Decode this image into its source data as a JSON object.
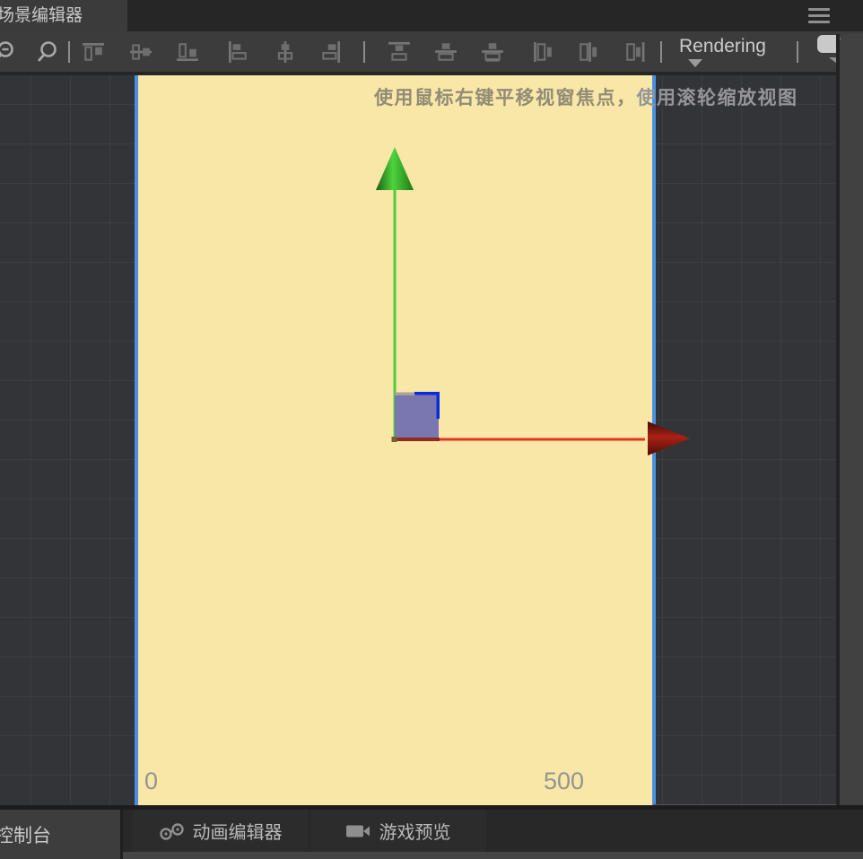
{
  "top_tabbar": {
    "tabs": [
      {
        "label": "场景编辑器",
        "active": true
      }
    ],
    "menu_icon": "hamburger-icon"
  },
  "toolbar": {
    "zoom_icons": [
      "zoom-out-icon",
      "zoom-in-icon"
    ],
    "align_icons": [
      "align-top-icon",
      "align-middle-icon",
      "align-bottom-icon",
      "align-left-icon",
      "align-center-icon",
      "align-right-icon"
    ],
    "distribute_icons": [
      "distribute-top-icon",
      "distribute-vcenter-icon",
      "distribute-bottom-icon",
      "distribute-left-icon",
      "distribute-hcenter-icon",
      "distribute-right-icon"
    ],
    "rendering_label": "Rendering",
    "layer_icon": "bubble-icon"
  },
  "scene_view": {
    "hint_pan": "使用鼠标右键平移视窗焦点，",
    "hint_zoom": "使用滚轮缩放视图",
    "ruler_start": "0",
    "ruler_end": "500",
    "colors": {
      "canvas_fill": "#f8e7a6",
      "canvas_border": "#4a90e2",
      "x_axis": "#e83222",
      "y_axis": "#4ccd3b",
      "sprite_fill": "#7976b0",
      "selection_outline": "#0b2be2",
      "grid_bg": "#333438"
    }
  },
  "bottom_tabbar": {
    "tabs": [
      {
        "label": "控制台",
        "active": true
      },
      {
        "label": "动画编辑器",
        "icon": "animation-icon"
      },
      {
        "label": "游戏预览",
        "icon": "game-preview-camera-icon"
      }
    ]
  }
}
